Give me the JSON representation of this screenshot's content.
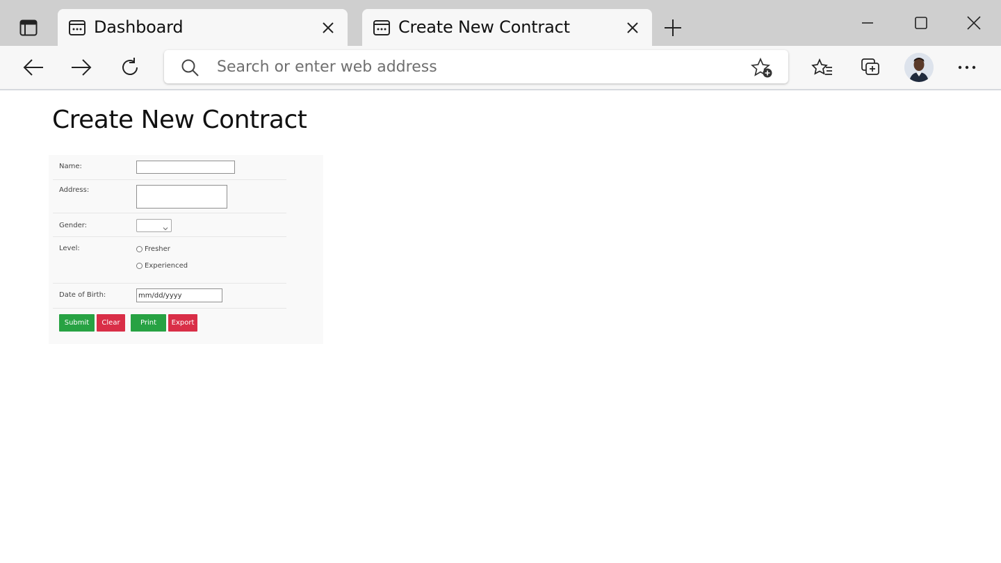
{
  "browser": {
    "tabs": [
      {
        "label": "Dashboard",
        "icon": "dashboard-tab-icon"
      },
      {
        "label": "Create New Contract",
        "icon": "dashboard-tab-icon"
      }
    ],
    "address_bar": {
      "placeholder": "Search or enter web address",
      "value": ""
    }
  },
  "page": {
    "title": "Create New Contract",
    "form": {
      "name_label": "Name:",
      "address_label": "Address:",
      "gender_label": "Gender:",
      "gender_selected": "",
      "level_label": "Level:",
      "level_options": [
        "Fresher",
        "Experienced"
      ],
      "dob_label": "Date of Birth:",
      "dob_value": "mm/dd/yyyy",
      "buttons": {
        "submit": "Submit",
        "clear": "Clear",
        "print": "Print",
        "export": "Export"
      }
    }
  },
  "colors": {
    "green_button": "#27a243",
    "red_button": "#d92e47",
    "tabstrip": "#cfcfcf"
  }
}
